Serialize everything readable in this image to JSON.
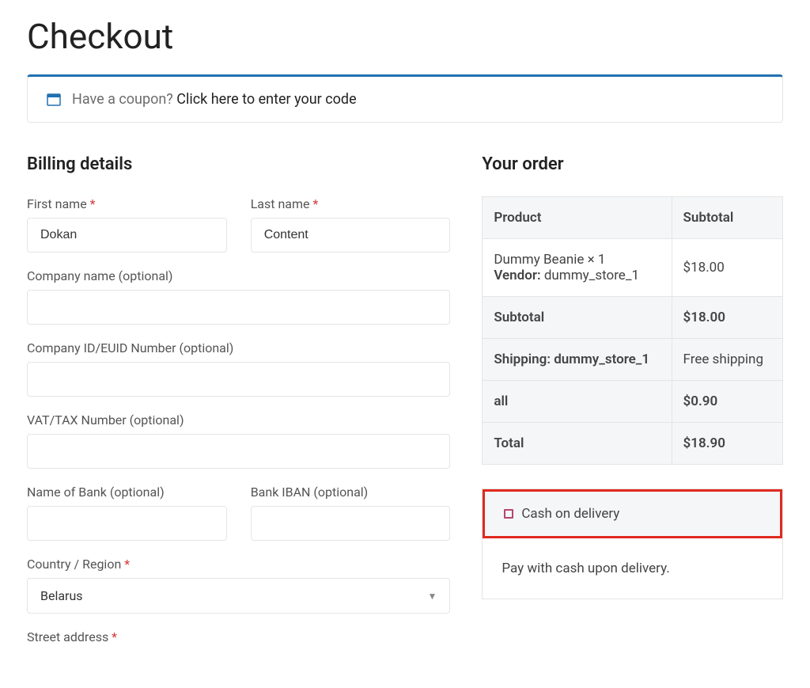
{
  "page_title": "Checkout",
  "coupon": {
    "prompt": "Have a coupon? ",
    "link_text": "Click here to enter your code"
  },
  "billing": {
    "title": "Billing details",
    "first_name_label": "First name ",
    "first_name_value": "Dokan",
    "last_name_label": "Last name ",
    "last_name_value": "Content",
    "company_label": "Company name (optional)",
    "company_id_label": "Company ID/EUID Number (optional)",
    "vat_label": "VAT/TAX Number (optional)",
    "bank_name_label": "Name of Bank (optional)",
    "bank_iban_label": "Bank IBAN (optional)",
    "country_label": "Country / Region ",
    "country_value": "Belarus",
    "street_label": "Street address "
  },
  "order": {
    "title": "Your order",
    "header_product": "Product",
    "header_subtotal": "Subtotal",
    "item_name": "Dummy Beanie  × 1",
    "vendor_label": "Vendor: ",
    "vendor_name": "dummy_store_1",
    "item_price": "$18.00",
    "subtotal_label": "Subtotal",
    "subtotal_value": "$18.00",
    "shipping_label": "Shipping: dummy_store_1",
    "shipping_value": "Free shipping",
    "all_label": "all",
    "all_value": "$0.90",
    "total_label": "Total",
    "total_value": "$18.90"
  },
  "payment": {
    "method_label": "Cash on delivery",
    "description": "Pay with cash upon delivery."
  }
}
